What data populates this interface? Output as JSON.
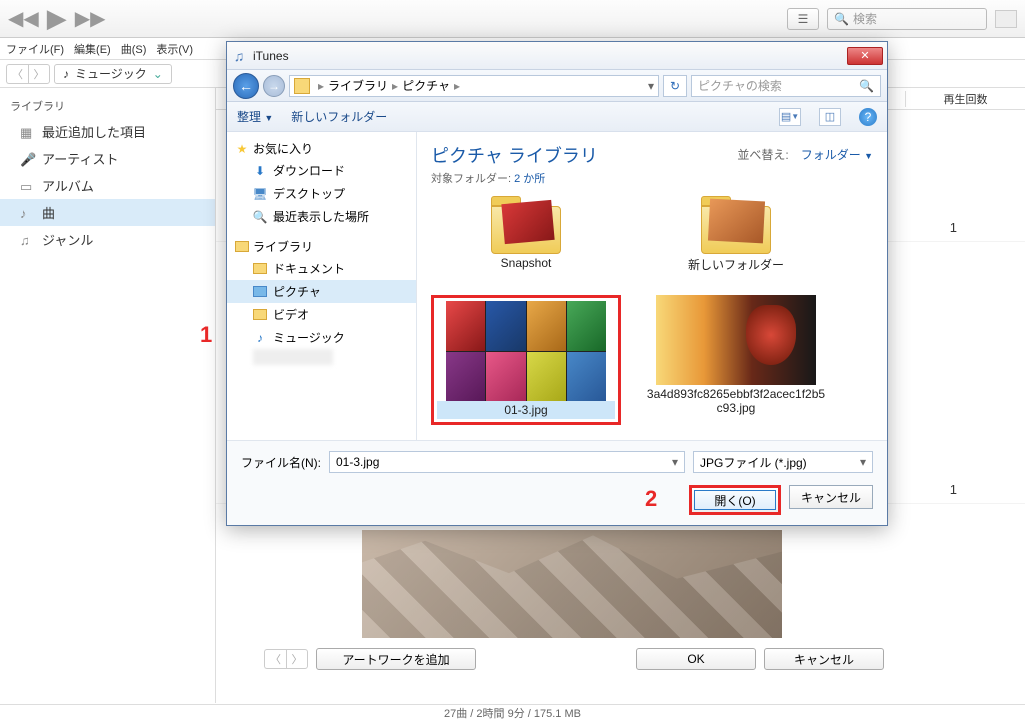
{
  "itunes": {
    "search_placeholder": "検索",
    "menubar": [
      "ファイル(F)",
      "編集(E)",
      "曲(S)",
      "表示(V)"
    ],
    "music_label": "ミュージック",
    "sidebar_header": "ライブラリ",
    "sidebar": [
      {
        "label": "最近追加した項目"
      },
      {
        "label": "アーティスト"
      },
      {
        "label": "アルバム"
      },
      {
        "label": "曲"
      },
      {
        "label": "ジャンル"
      }
    ],
    "col_plays": "再生回数",
    "play_count_1": "1",
    "play_count_2": "1",
    "artwork_btn": "アートワークを追加",
    "ok_btn": "OK",
    "cancel_btn": "キャンセル",
    "statusbar": "27曲 / 2時間 9分 / 175.1 MB"
  },
  "dialog": {
    "title": "iTunes",
    "breadcrumb": [
      "ライブラリ",
      "ピクチャ"
    ],
    "search_placeholder": "ピクチャの検索",
    "toolbar": {
      "organize": "整理",
      "new_folder": "新しいフォルダー"
    },
    "sidebar": {
      "favorites": {
        "header": "お気に入り",
        "items": [
          "ダウンロード",
          "デスクトップ",
          "最近表示した場所"
        ]
      },
      "libraries": {
        "header": "ライブラリ",
        "items": [
          "ドキュメント",
          "ピクチャ",
          "ビデオ",
          "ミュージック"
        ]
      }
    },
    "content": {
      "title": "ピクチャ ライブラリ",
      "subfolder_label": "対象フォルダー:",
      "subfolder_count": "2 か所",
      "sort_label": "並べ替え:",
      "sort_value": "フォルダー",
      "items": [
        {
          "label": "Snapshot"
        },
        {
          "label": "新しいフォルダー"
        },
        {
          "label": "01-3.jpg"
        },
        {
          "label": "3a4d893fc8265ebbf3f2acec1f2b5c93.jpg"
        }
      ]
    },
    "filename_label": "ファイル名(N):",
    "filename_value": "01-3.jpg",
    "filter": "JPGファイル (*.jpg)",
    "open_btn": "開く(O)",
    "cancel_btn": "キャンセル"
  },
  "callouts": {
    "c1": "1",
    "c2": "2"
  }
}
